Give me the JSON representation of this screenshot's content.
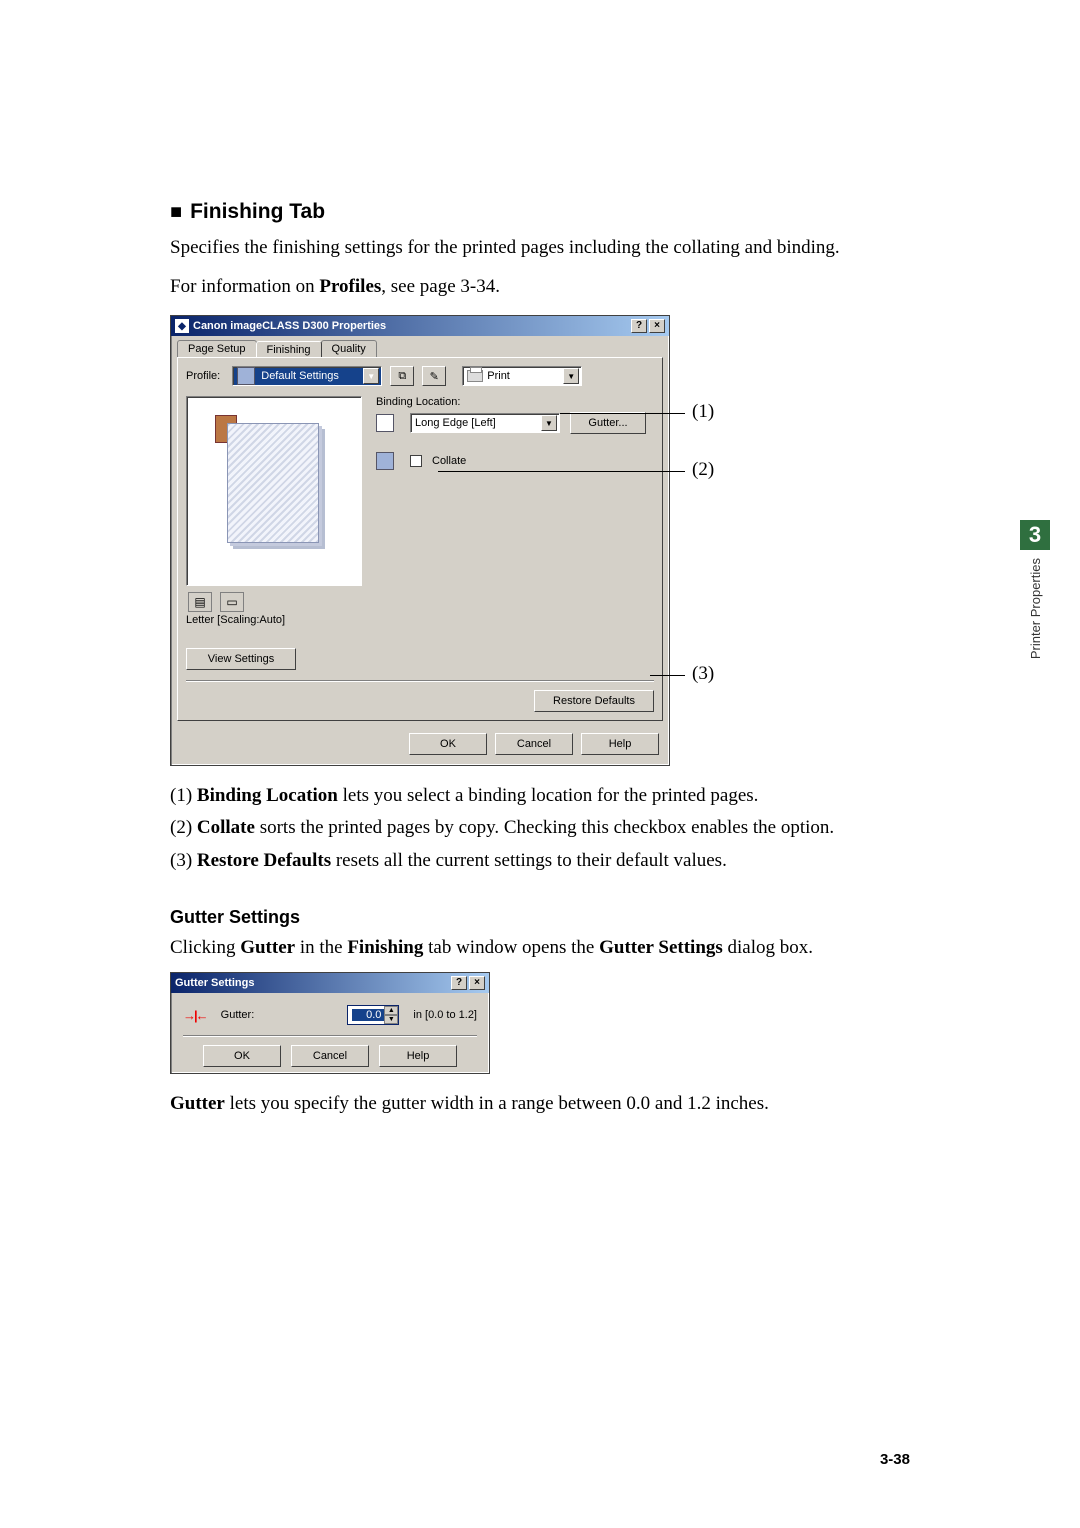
{
  "heading_prefix": "■",
  "heading": "Finishing Tab",
  "intro1": "Specifies the finishing settings for the printed pages including the collating and binding.",
  "intro2_a": "For information on ",
  "intro2_b": "Profiles",
  "intro2_c": ", see page 3-34.",
  "dialog": {
    "title": "Canon imageCLASS D300 Properties",
    "tabs": {
      "page_setup": "Page Setup",
      "finishing": "Finishing",
      "quality": "Quality"
    },
    "profile_lbl": "Profile:",
    "profile_val": "Default Settings",
    "output_val": "Print",
    "binding_lbl": "Binding Location:",
    "binding_val": "Long Edge [Left]",
    "gutter_btn": "Gutter...",
    "collate_lbl": "Collate",
    "preview_caption": "Letter [Scaling:Auto]",
    "view_settings": "View Settings",
    "restore_defaults": "Restore Defaults",
    "ok": "OK",
    "cancel": "Cancel",
    "help": "Help"
  },
  "callouts": {
    "c1": "(1)",
    "c2": "(2)",
    "c3": "(3)"
  },
  "list": {
    "l1a": "(1) ",
    "l1b": "Binding Location",
    "l1c": " lets you select a binding location for the printed pages.",
    "l2a": "(2) ",
    "l2b": "Collate",
    "l2c": " sorts the printed pages by copy. Checking this checkbox enables the option.",
    "l3a": "(3) ",
    "l3b": "Restore Defaults",
    "l3c": " resets all the current settings to their default values."
  },
  "gutter_heading": "Gutter Settings",
  "gutter_intro_a": "Clicking ",
  "gutter_intro_b": "Gutter",
  "gutter_intro_c": " in the ",
  "gutter_intro_d": "Finishing",
  "gutter_intro_e": " tab window opens the ",
  "gutter_intro_f": "Gutter Settings",
  "gutter_intro_g": " dialog box.",
  "gutter_dialog": {
    "title": "Gutter Settings",
    "lbl": "Gutter:",
    "val": "0.0",
    "range": "in [0.0 to 1.2]",
    "ok": "OK",
    "cancel": "Cancel",
    "help": "Help"
  },
  "gutter_explain_a": "Gutter",
  "gutter_explain_b": " lets you specify the gutter width in a range between 0.0 and 1.2 inches.",
  "side": {
    "num": "3",
    "txt": "Printer Properties"
  },
  "pgnum": "3-38"
}
